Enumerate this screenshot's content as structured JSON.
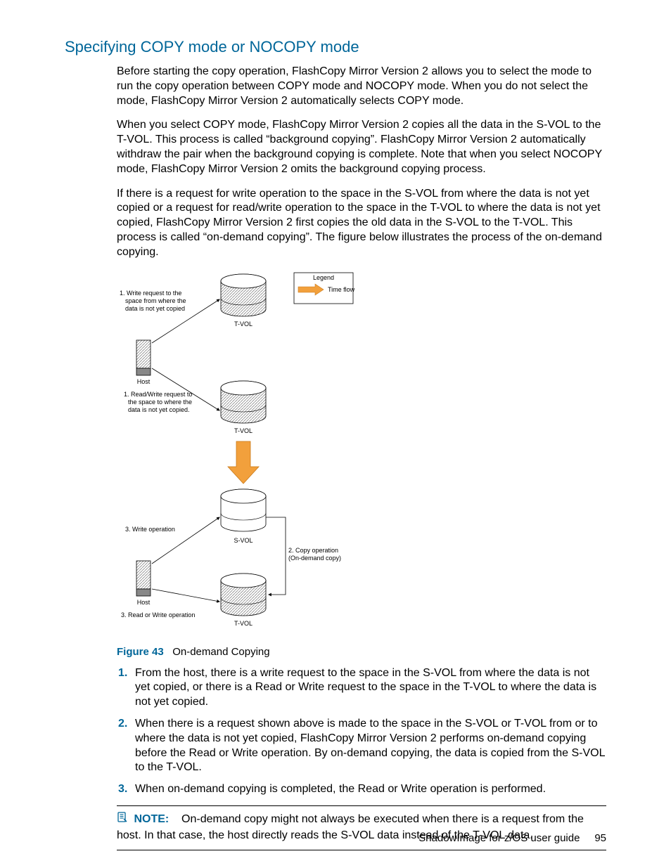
{
  "heading": "Specifying COPY mode or NOCOPY mode",
  "paragraphs": {
    "p1": "Before starting the copy operation, FlashCopy Mirror Version 2 allows you to select the mode to run the copy operation between COPY mode and NOCOPY mode. When you do not select the mode, FlashCopy Mirror Version 2 automatically selects COPY mode.",
    "p2": "When you select COPY mode, FlashCopy Mirror Version 2 copies all the data in the S-VOL to the T-VOL. This process is called “background copying”. FlashCopy Mirror Version 2 automatically withdraw the pair when the background copying is complete. Note that when you select NOCOPY mode, FlashCopy Mirror Version 2 omits the background copying process.",
    "p3": "If there is a request for write operation to the space in the S-VOL from where the data is not yet copied or a request for read/write operation to the space in the T-VOL to where the data is not yet copied, FlashCopy Mirror Version 2 first copies the old data in the S-VOL to the T-VOL. This process is called “on-demand copying”. The figure below illustrates the process of the on-demand copying."
  },
  "figure": {
    "lead": "Figure 43",
    "caption": "On-demand Copying",
    "labels": {
      "legend": "Legend",
      "timeflow": "Time flow",
      "host": "Host",
      "tvol": "T-VOL",
      "svol": "S-VOL",
      "top_write_l1": "1. Write request to the",
      "top_write_l2": "space from where the",
      "top_write_l3": "data is not yet copied",
      "top_read_l1": "1. Read/Write request to",
      "top_read_l2": "the space to where the",
      "top_read_l3": "data is not yet copied.",
      "write_op": "3. Write operation",
      "read_write_op": "3. Read or Write operation",
      "copy_op_l1": "2. Copy operation",
      "copy_op_l2": "(On-demand copy)"
    }
  },
  "list": {
    "i1": "From the host, there is a write request to the space in the S-VOL from where the data is not yet copied, or there is a Read or Write request to the space in the T-VOL to where the data is not yet copied.",
    "i2": "When there is a request shown above is made to the space in the S-VOL or T-VOL from or to where the data is not yet copied, FlashCopy Mirror Version 2 performs on-demand copying before the Read or Write operation. By on-demand copying, the data is copied from the S-VOL to the T-VOL.",
    "i3": "When on-demand copying is completed, the Read or Write operation is performed."
  },
  "note": {
    "label": "NOTE:",
    "text": "On-demand copy might not always be executed when there is a request from the host. In that case, the host directly reads the S-VOL data instead of the T-VOL data."
  },
  "footer": {
    "title": "ShadowImage for z/OS user guide",
    "page": "95"
  }
}
